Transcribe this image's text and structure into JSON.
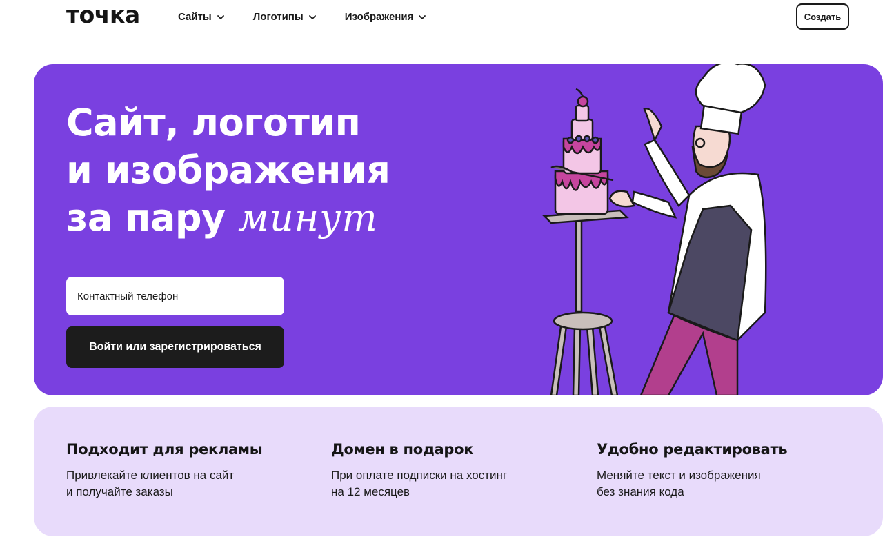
{
  "header": {
    "logo": "точка",
    "nav": [
      {
        "label": "Сайты"
      },
      {
        "label": "Логотипы"
      },
      {
        "label": "Изображения"
      }
    ],
    "create_button": "Создать"
  },
  "hero": {
    "title_line1": "Сайт, логотип",
    "title_line2": "и изображения",
    "title_line3_prefix": "за пару",
    "title_line3_accent": "минут",
    "phone_placeholder": "Контактный телефон",
    "login_button": "Войти или зарегистрироваться",
    "illustration": "chef-decorating-cake"
  },
  "features": [
    {
      "title": "Подходит для рекламы",
      "line1": "Привлекайте клиентов на сайт",
      "line2": "и получайте заказы"
    },
    {
      "title": "Домен в подарок",
      "line1": "При оплате подписки на хостинг",
      "line2": "на 12 месяцев"
    },
    {
      "title": "Удобно редактировать",
      "line1": "Меняйте текст и изображения",
      "line2": "без знания кода"
    }
  ],
  "colors": {
    "hero_bg": "#7a40e0",
    "features_bg": "#e8dbfb",
    "button_dark": "#1c1c1c"
  }
}
